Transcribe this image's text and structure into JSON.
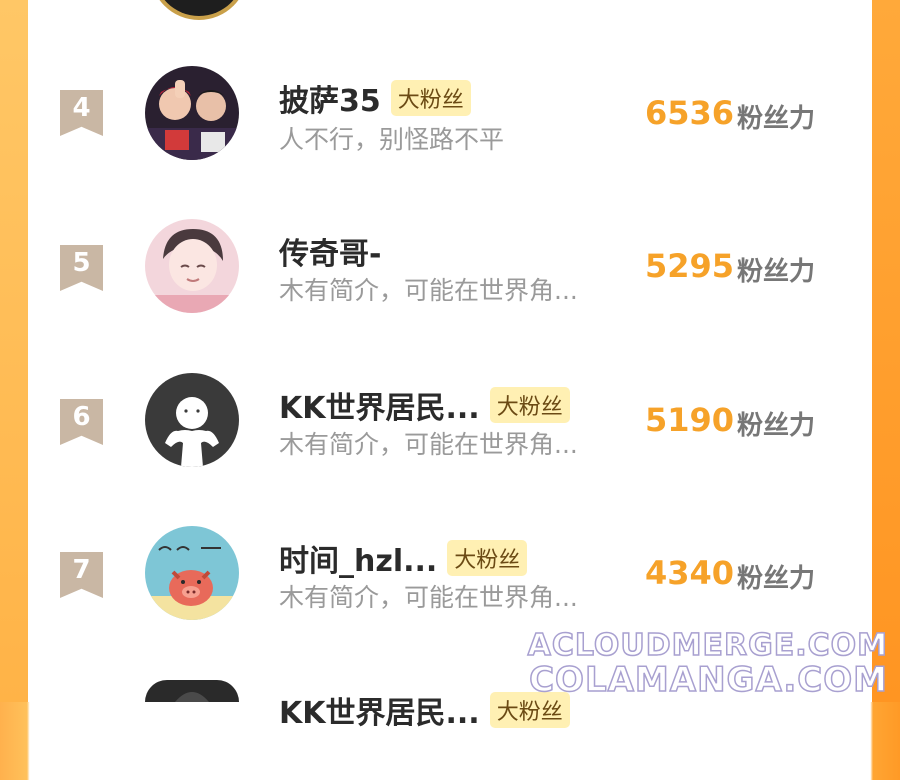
{
  "rows": [
    {
      "rank": "4",
      "name": "披萨35",
      "badge": "大粉丝",
      "bio": "人不行，别怪路不平",
      "score": "6536",
      "unit": "粉丝力"
    },
    {
      "rank": "5",
      "name": "传奇哥-",
      "badge": "",
      "bio": "木有简介，可能在世界角...",
      "score": "5295",
      "unit": "粉丝力"
    },
    {
      "rank": "6",
      "name": "KK世界居民...",
      "badge": "大粉丝",
      "bio": "木有简介，可能在世界角...",
      "score": "5190",
      "unit": "粉丝力"
    },
    {
      "rank": "7",
      "name": "时间_hzl...",
      "badge": "大粉丝",
      "bio": "木有简介，可能在世界角...",
      "score": "4340",
      "unit": "粉丝力"
    },
    {
      "rank": "",
      "name": "KK世界居民...",
      "badge": "大粉丝",
      "bio": "",
      "score": "",
      "unit": ""
    }
  ],
  "watermark": {
    "line1": "ACLOUDMERGE.COM",
    "line2": "COLAMANGA.COM"
  },
  "colors": {
    "accent": "#f6a229",
    "badge_bg": "#fff0b3",
    "rank_bg": "#c9b7a4"
  }
}
